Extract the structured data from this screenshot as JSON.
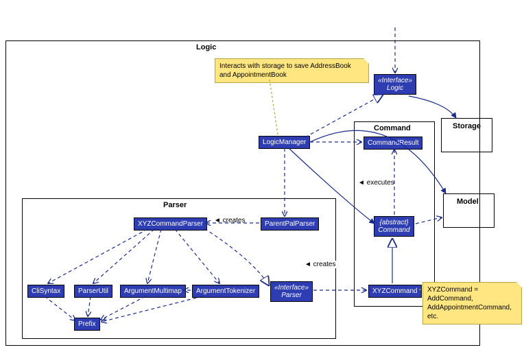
{
  "packages": {
    "logic": "Logic",
    "parser": "Parser",
    "command": "Command"
  },
  "externals": {
    "storage": "Storage",
    "model": "Model"
  },
  "classes": {
    "logicIf": {
      "stereo": "«Interface»",
      "name": "Logic"
    },
    "logicManager": "LogicManager",
    "parentPalParser": "ParentPalParser",
    "xyzCommandParser": "XYZCommandParser",
    "cliSyntax": "CliSyntax",
    "parserUtil": "ParserUtil",
    "argumentMultimap": "ArgumentMultimap",
    "argumentTokenizer": "ArgumentTokenizer",
    "parserIf": {
      "stereo": "«Interface»",
      "name": "Parser"
    },
    "prefix": "Prefix",
    "commandResult": "CommandResult",
    "commandAbs": {
      "stereo": "{abstract}",
      "name": "Command"
    },
    "xyzCommand": "XYZCommand"
  },
  "notes": {
    "storageNote": "Interacts with storage to save AddressBook and AppointmentBook",
    "xyzNote": "XYZCommand = AddCommand, AddAppointmentCommand, etc."
  },
  "edgeLabels": {
    "creates1": "◄ creates",
    "creates2": "◄ creates",
    "executes": "◄ executes"
  }
}
